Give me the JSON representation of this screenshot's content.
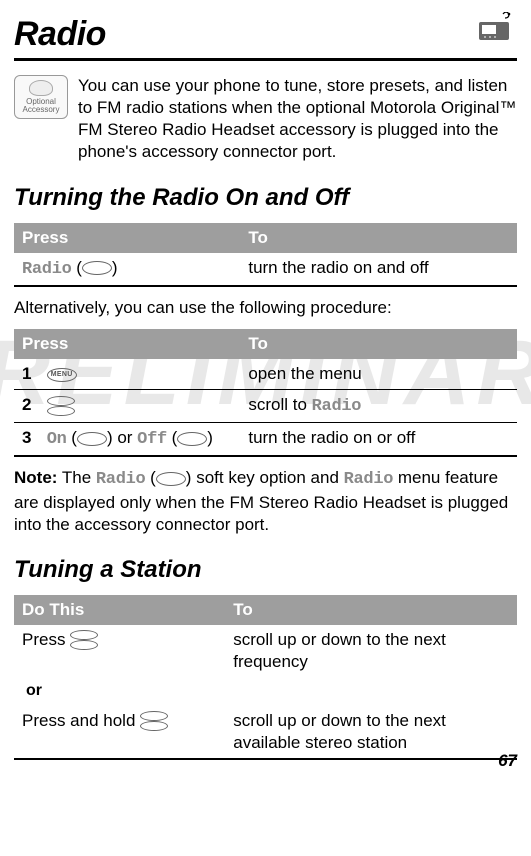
{
  "page": {
    "title": "Radio",
    "number": "67",
    "watermark": "PRELIMINARY"
  },
  "badge": {
    "line1": "Optional",
    "line2": "Accessory"
  },
  "intro": "You can use your phone to tune, store presets, and listen to FM radio stations when the optional Motorola Original™ FM Stereo Radio Headset accessory is plugged into the phone's accessory connector port.",
  "sections": {
    "s1_title": "Turning the Radio On and Off",
    "s2_title": "Tuning a Station"
  },
  "table_headers": {
    "press": "Press",
    "to": "To",
    "dothis": "Do This"
  },
  "t1": {
    "left_soft": "Radio",
    "left_paren": "(",
    "left_paren_close": ")",
    "right": "turn the radio on and off"
  },
  "alt_text": "Alternatively, you can use the following procedure:",
  "t2": {
    "r1": {
      "n": "1",
      "right": "open the menu"
    },
    "r2": {
      "n": "2",
      "right_pre": "scroll to ",
      "right_soft": "Radio"
    },
    "r3": {
      "n": "3",
      "l_on": "On",
      "l_or": " or ",
      "l_off": "Off",
      "right": "turn the radio on or off"
    }
  },
  "note": {
    "label": "Note:",
    "t1": " The ",
    "soft1": "Radio",
    "t2": " soft key option and ",
    "soft2": "Radio",
    "t3": " menu feature are displayed only when the FM Stereo Radio Headset is plugged into the accessory connector port."
  },
  "t3": {
    "r1": {
      "left": "Press ",
      "right": "scroll up or down to the next frequency"
    },
    "or": "or",
    "r2": {
      "left": "Press and hold ",
      "right": "scroll up or down to the next available stereo station"
    }
  }
}
